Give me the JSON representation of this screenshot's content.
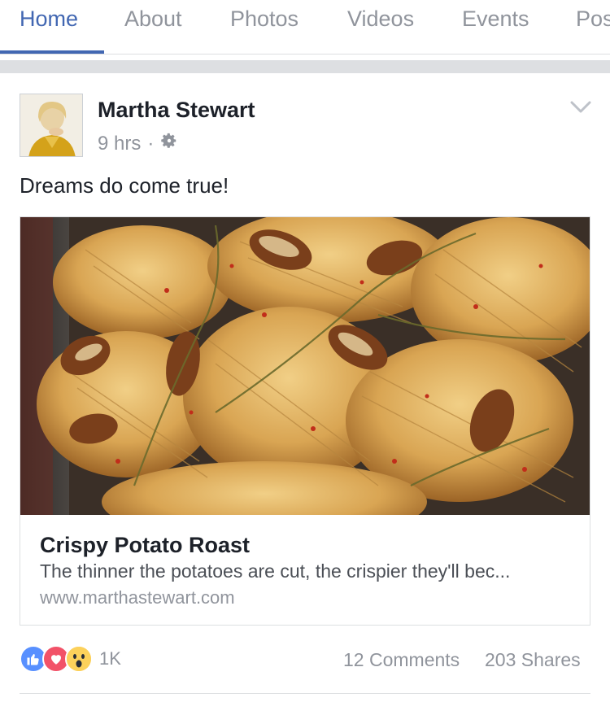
{
  "tabs": [
    "Home",
    "About",
    "Photos",
    "Videos",
    "Events",
    "Pos"
  ],
  "active_tab": "Home",
  "post": {
    "author": "Martha Stewart",
    "time": "9 hrs",
    "dot": "·",
    "caption": "Dreams do come true!",
    "link": {
      "title": "Crispy Potato Roast",
      "description": "The thinner the potatoes are cut, the crispier they'll bec...",
      "domain": "www.marthastewart.com"
    },
    "reactions": {
      "icons": [
        "like-icon",
        "love-icon",
        "wow-icon"
      ],
      "count": "1K"
    },
    "comments": "12 Comments",
    "shares": "203 Shares"
  },
  "colors": {
    "accent": "#4267b2",
    "muted": "#90949c",
    "like": "#5890ff",
    "love": "#f25268",
    "wow": "#fcd15b"
  }
}
